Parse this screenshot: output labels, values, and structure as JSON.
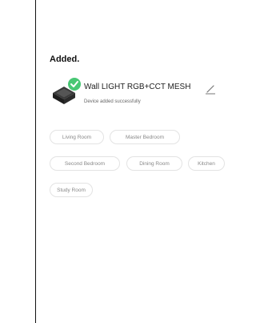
{
  "page": {
    "heading": "Added."
  },
  "device": {
    "name": "Wall LIGHT RGB+CCT MESH",
    "status": "Device added successfully",
    "icon": "light-bulb-icon",
    "status_icon": "check-icon",
    "edit_icon": "pencil-icon"
  },
  "rooms": [
    "Living Room",
    "Master Bedroom",
    "Second Bedroom",
    "Dining Room",
    "Kitchen",
    "Study Room"
  ],
  "colors": {
    "success": "#48c774",
    "border": "#e3e3e3",
    "text_muted": "#888888"
  }
}
